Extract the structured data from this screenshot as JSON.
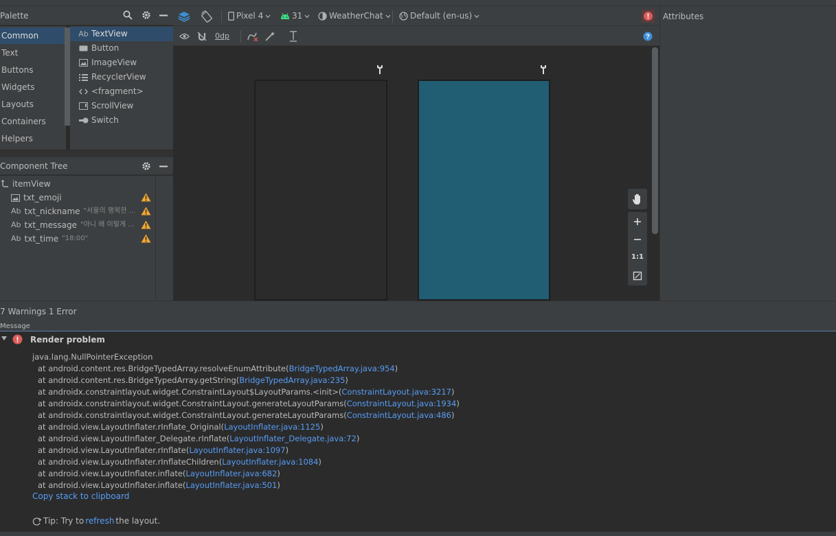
{
  "palette": {
    "title": "Palette",
    "categories": [
      "Common",
      "Text",
      "Buttons",
      "Widgets",
      "Layouts",
      "Containers",
      "Helpers"
    ],
    "selected_category": "Common",
    "items": [
      {
        "icon": "textview-icon",
        "label": "TextView",
        "prefix": "Ab"
      },
      {
        "icon": "button-icon",
        "label": "Button",
        "prefix": ""
      },
      {
        "icon": "imageview-icon",
        "label": "ImageView",
        "prefix": ""
      },
      {
        "icon": "recyclerview-icon",
        "label": "RecyclerView",
        "prefix": ""
      },
      {
        "icon": "fragment-icon",
        "label": "<fragment>",
        "prefix": ""
      },
      {
        "icon": "scrollview-icon",
        "label": "ScrollView",
        "prefix": ""
      },
      {
        "icon": "switch-icon",
        "label": "Switch",
        "prefix": ""
      }
    ]
  },
  "component_tree": {
    "title": "Component Tree",
    "root": "itemView",
    "nodes": [
      {
        "icon": "image-icon",
        "prefix": "",
        "name": "txt_emoji",
        "sub": ""
      },
      {
        "icon": "text-icon",
        "prefix": "Ab",
        "name": "txt_nickname",
        "sub": "\"서울의 행복한 ..."
      },
      {
        "icon": "text-icon",
        "prefix": "Ab",
        "name": "txt_message",
        "sub": "\"아니 왜 이렇게 ..."
      },
      {
        "icon": "text-icon",
        "prefix": "Ab",
        "name": "txt_time",
        "sub": "\"18:00\""
      }
    ]
  },
  "toolbar": {
    "device": "Pixel 4",
    "api": "31",
    "theme": "WeatherChat",
    "locale": "Default (en-us)",
    "margin": "0dp"
  },
  "zoom": {
    "one_to_one": "1:1"
  },
  "attributes": {
    "title": "Attributes"
  },
  "issues": {
    "title": "7 Warnings 1 Error",
    "message_header": "Message",
    "problem_title": "Render problem",
    "exception": "java.lang.NullPointerException",
    "stack": [
      {
        "text": "at android.content.res.BridgeTypedArray.resolveEnumAttribute(",
        "link": "BridgeTypedArray.java:954",
        "end": ")"
      },
      {
        "text": "at android.content.res.BridgeTypedArray.getString(",
        "link": "BridgeTypedArray.java:235",
        "end": ")"
      },
      {
        "text": "at androidx.constraintlayout.widget.ConstraintLayout$LayoutParams.<init>(",
        "link": "ConstraintLayout.java:3217",
        "end": ")"
      },
      {
        "text": "at androidx.constraintlayout.widget.ConstraintLayout.generateLayoutParams(",
        "link": "ConstraintLayout.java:1934",
        "end": ")"
      },
      {
        "text": "at androidx.constraintlayout.widget.ConstraintLayout.generateLayoutParams(",
        "link": "ConstraintLayout.java:486",
        "end": ")"
      },
      {
        "text": "at android.view.LayoutInflater.rInflate_Original(",
        "link": "LayoutInflater.java:1125",
        "end": ")"
      },
      {
        "text": "at android.view.LayoutInflater_Delegate.rInflate(",
        "link": "LayoutInflater_Delegate.java:72",
        "end": ")"
      },
      {
        "text": "at android.view.LayoutInflater.rInflate(",
        "link": "LayoutInflater.java:1097",
        "end": ")"
      },
      {
        "text": "at android.view.LayoutInflater.rInflateChildren(",
        "link": "LayoutInflater.java:1084",
        "end": ")"
      },
      {
        "text": "at android.view.LayoutInflater.inflate(",
        "link": "LayoutInflater.java:682",
        "end": ")"
      },
      {
        "text": "at android.view.LayoutInflater.inflate(",
        "link": "LayoutInflater.java:501",
        "end": ")"
      }
    ],
    "copy_link": "Copy stack to clipboard",
    "tip_prefix": "Tip: Try to ",
    "tip_link": "refresh",
    "tip_suffix": " the layout."
  },
  "colors": {
    "panel": "#3c3f41",
    "editor": "#2b2b2b",
    "selection": "#2f4d6b",
    "blueprint": "#215d73",
    "link": "#589df6",
    "warning": "#f0a732",
    "error": "#db5c5c"
  }
}
